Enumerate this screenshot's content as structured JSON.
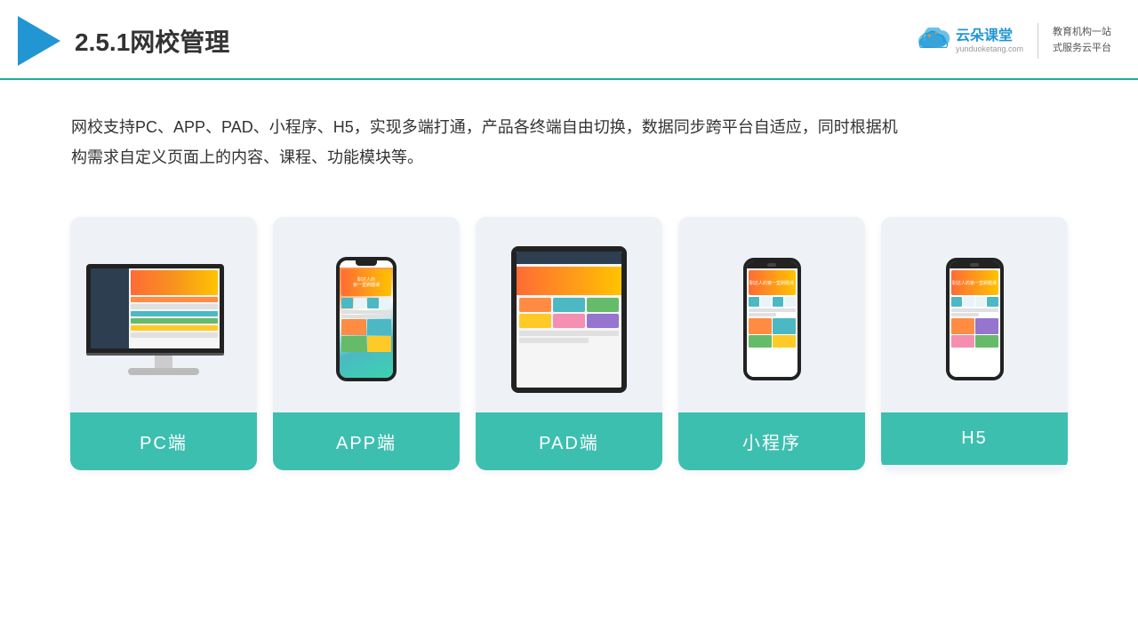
{
  "header": {
    "title": "2.5.1网校管理",
    "logo_name": "云朵课堂",
    "logo_url": "yunduoketang.com",
    "slogan_line1": "教育机构一站",
    "slogan_line2": "式服务云平台"
  },
  "description": {
    "text": "网校支持PC、APP、PAD、小程序、H5，实现多端打通，产品各终端自由切换，数据同步跨平台自适应，同时根据机构需求自定义页面上的内容、课程、功能模块等。"
  },
  "cards": [
    {
      "id": "pc",
      "label": "PC端"
    },
    {
      "id": "app",
      "label": "APP端"
    },
    {
      "id": "pad",
      "label": "PAD端"
    },
    {
      "id": "miniapp",
      "label": "小程序"
    },
    {
      "id": "h5",
      "label": "H5"
    }
  ],
  "colors": {
    "accent": "#3dbfb0",
    "header_border": "#1ab394",
    "logo_blue": "#2196d3"
  }
}
